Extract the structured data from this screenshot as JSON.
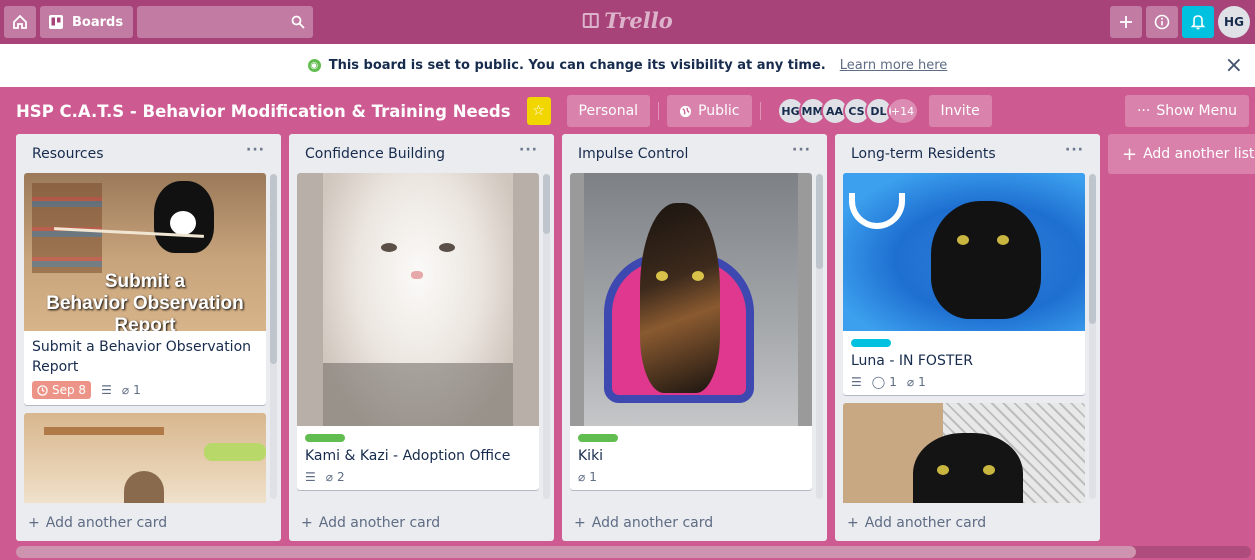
{
  "header": {
    "boards_label": "Boards",
    "logo_text": "Trello",
    "user_initials": "HG"
  },
  "banner": {
    "message": "This board is set to public. You can change its visibility at any time.",
    "learn_more": "Learn more here",
    "close": "×"
  },
  "board": {
    "title": "HSP C.A.T.S - Behavior Modification & Training Needs",
    "team": "Personal",
    "visibility": "Public",
    "members": [
      "HG",
      "MM",
      "AA",
      "CS",
      "DL"
    ],
    "more_members": "+14",
    "invite": "Invite",
    "show_menu": "Show Menu"
  },
  "lists": [
    {
      "title": "Resources",
      "card1": {
        "cover_line1": "Submit a",
        "cover_line2": "Behavior Observation Report",
        "title": "Submit a Behavior Observation Report",
        "due": "Sep 8",
        "attachments": "1"
      }
    },
    {
      "title": "Confidence Building",
      "card1": {
        "title": "Kami & Kazi - Adoption Office",
        "attachments": "2",
        "label_color": "#61bd4f"
      }
    },
    {
      "title": "Impulse Control",
      "card1": {
        "title": "Kiki",
        "attachments": "1",
        "label_color": "#61bd4f"
      }
    },
    {
      "title": "Long-term Residents",
      "card1": {
        "title": "Luna - IN FOSTER",
        "comments": "1",
        "attachments": "1",
        "label_color": "#00c2e0"
      }
    }
  ],
  "add_card_label": "Add another card",
  "add_list_label": "Add another list",
  "colors": {
    "board_bg": "#cd5a91",
    "header_bg": "#a8437a",
    "list_bg": "#ebecf0",
    "due_bg": "#ec9488"
  }
}
